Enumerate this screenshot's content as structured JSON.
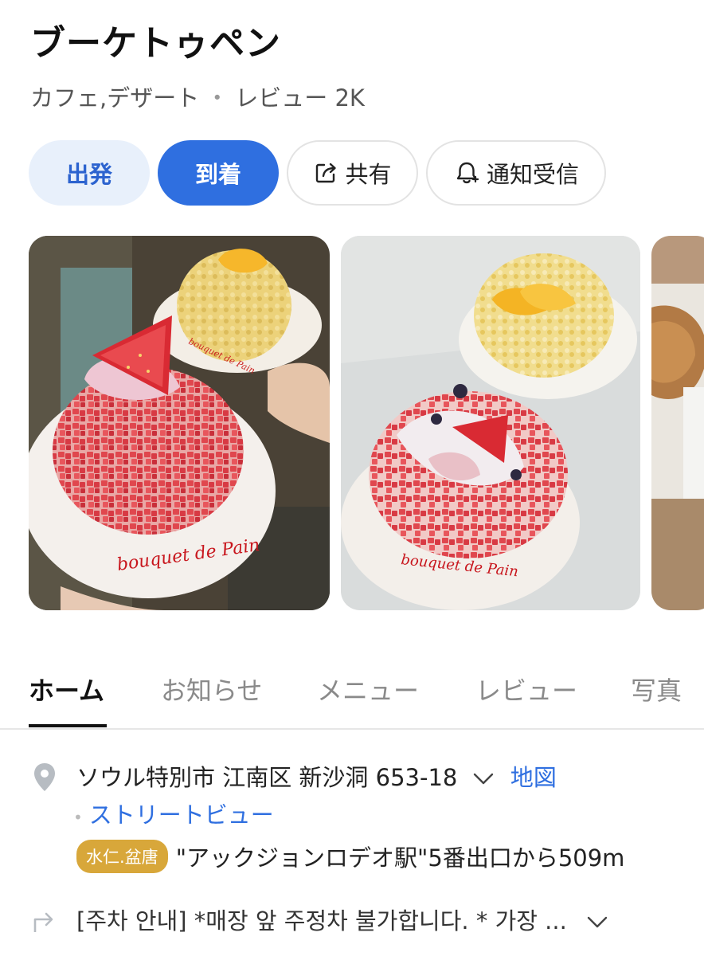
{
  "place": {
    "name": "ブーケトゥペン",
    "category": "カフェ,デザート",
    "separator": "・",
    "review_summary": "レビュー 2K"
  },
  "actions": {
    "depart_label": "出発",
    "arrive_label": "到着",
    "share_label": "共有",
    "notify_label": "通知受信"
  },
  "photos": {
    "plate_text_1": "bouquet de Pain",
    "plate_text_2": "bouquet de Pain"
  },
  "tabs": [
    {
      "label": "ホーム",
      "active": true
    },
    {
      "label": "お知らせ",
      "active": false
    },
    {
      "label": "メニュー",
      "active": false
    },
    {
      "label": "レビュー",
      "active": false
    },
    {
      "label": "写真",
      "active": false
    }
  ],
  "info": {
    "address": "ソウル特別市 江南区 新沙洞 653-18",
    "map_link": "地図",
    "street_view": "ストリートビュー",
    "station_badge": "水仁.盆唐",
    "station_text": "\"アックジョンロデオ駅\"5番出口から509m",
    "parking_text": "[주차 안내] *매장 앞 주정차 불가합니다. * 가장 ..."
  },
  "colors": {
    "accent": "#2f6fe0",
    "depart_bg": "#e8f0fb",
    "badge": "#d8a73a"
  },
  "icons": [
    "share-icon",
    "bell-icon",
    "location-pin-icon",
    "chevron-down-icon",
    "turn-arrow-icon"
  ]
}
